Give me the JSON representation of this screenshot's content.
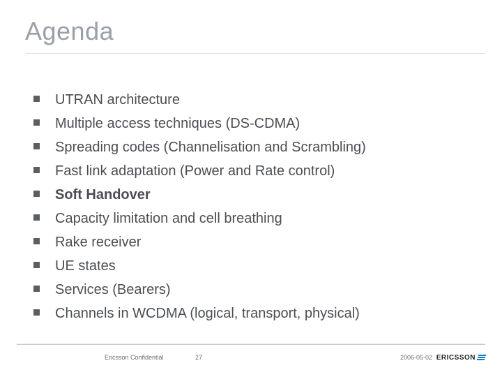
{
  "title": "Agenda",
  "items": [
    {
      "text": "UTRAN architecture",
      "bold": false
    },
    {
      "text": "Multiple access techniques (DS-CDMA)",
      "bold": false
    },
    {
      "text": "Spreading codes (Channelisation and Scrambling)",
      "bold": false
    },
    {
      "text": "Fast link adaptation (Power and Rate control)",
      "bold": false
    },
    {
      "text": "Soft Handover",
      "bold": true
    },
    {
      "text": "Capacity limitation and cell breathing",
      "bold": false
    },
    {
      "text": "Rake receiver",
      "bold": false
    },
    {
      "text": "UE states",
      "bold": false
    },
    {
      "text": "Services (Bearers)",
      "bold": false
    },
    {
      "text": "Channels in WCDMA (logical, transport, physical)",
      "bold": false
    }
  ],
  "footer": {
    "confidential": "Ericsson Confidential",
    "page": "27",
    "date": "2006-05-02",
    "logo_text": "ERICSSON"
  }
}
